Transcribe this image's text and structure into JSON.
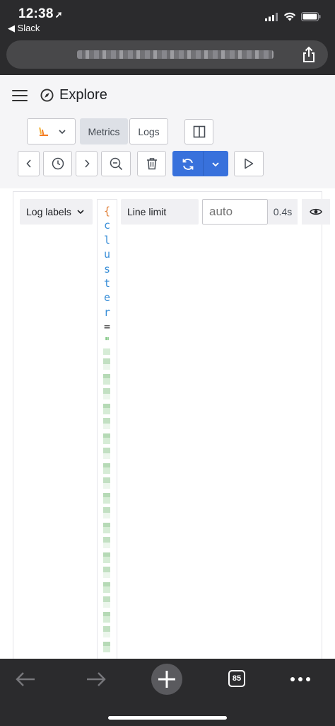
{
  "status_bar": {
    "time": "12:38",
    "location_arrow": "➚",
    "back_app": "◀ Slack"
  },
  "browser": {
    "url_blurred": true,
    "tabs_count": "85"
  },
  "header": {
    "title": "Explore"
  },
  "toolbar": {
    "datasource_icon": "loki-icon",
    "metrics_label": "Metrics",
    "logs_label": "Logs"
  },
  "query": {
    "log_labels_label": "Log labels",
    "vertical_text": [
      {
        "ch": "{",
        "kind": "brace"
      },
      {
        "ch": "c",
        "kind": "key"
      },
      {
        "ch": "l",
        "kind": "key"
      },
      {
        "ch": "u",
        "kind": "key"
      },
      {
        "ch": "s",
        "kind": "key"
      },
      {
        "ch": "t",
        "kind": "key"
      },
      {
        "ch": "e",
        "kind": "key"
      },
      {
        "ch": "r",
        "kind": "key"
      },
      {
        "ch": "=",
        "kind": "op"
      },
      {
        "ch": "\"",
        "kind": "str"
      }
    ],
    "line_limit_label": "Line limit",
    "line_limit_placeholder": "auto",
    "timing": "0.4s"
  },
  "colors": {
    "chrome_dark": "#2b2b2d",
    "run_blue": "#3871dc",
    "brace_orange": "#e1813a",
    "key_blue": "#3a8fd8",
    "string_green": "#4caf50"
  }
}
